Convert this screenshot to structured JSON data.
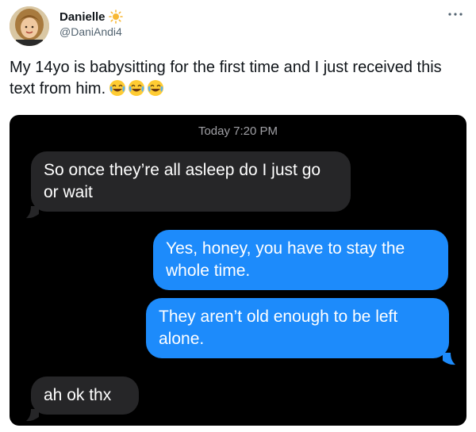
{
  "tweet": {
    "author": {
      "display_name": "Danielle",
      "handle": "@DaniAndi4",
      "name_emoji_icon": "sun-icon"
    },
    "more_icon": "more-options-icon",
    "text": "My 14yo is babysitting for the first time and I just received this text from him.",
    "trailing_emojis": [
      "face-with-tears-of-joy-icon",
      "face-with-tears-of-joy-icon",
      "face-with-tears-of-joy-icon"
    ]
  },
  "conversation": {
    "timestamp": "Today 7:20 PM",
    "messages": [
      {
        "direction": "incoming",
        "text": "So once they’re all asleep do I just go or wait"
      },
      {
        "direction": "outgoing",
        "text": "Yes, honey, you have to stay the whole time."
      },
      {
        "direction": "outgoing",
        "text": "They aren’t old enough to be left alone."
      },
      {
        "direction": "incoming",
        "text": "ah ok thx"
      }
    ]
  },
  "colors": {
    "incoming_bubble": "#262628",
    "outgoing_bubble": "#1d8bfb",
    "screenshot_bg": "#000000",
    "handle_text": "#536471"
  }
}
